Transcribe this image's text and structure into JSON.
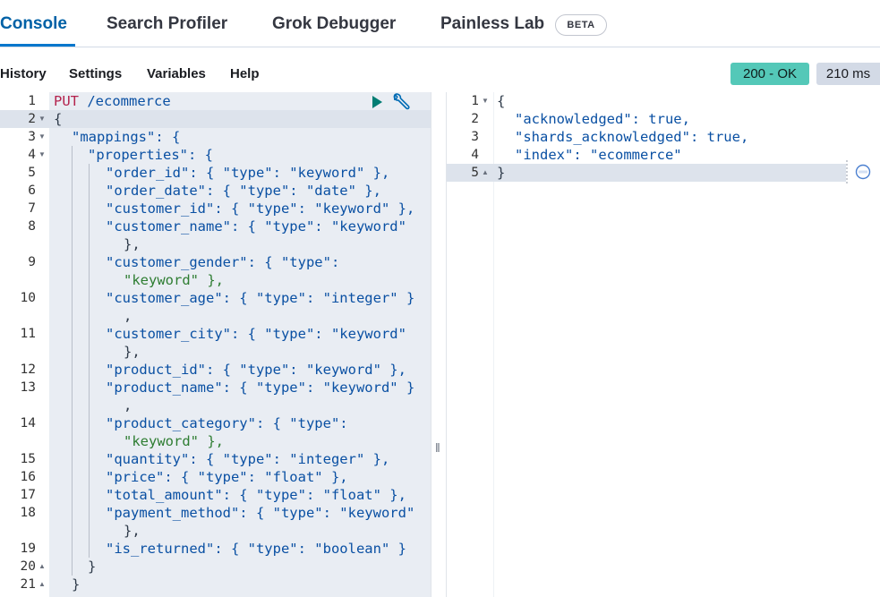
{
  "tabs": [
    "Console",
    "Search Profiler",
    "Grok Debugger",
    "Painless Lab"
  ],
  "beta_label": "BETA",
  "toolbar": [
    "History",
    "Settings",
    "Variables",
    "Help"
  ],
  "status": "200 - OK",
  "time": "210 ms",
  "request": {
    "method": "PUT",
    "path": "/ecommerce",
    "line_numbers": [
      "1",
      "2",
      "3",
      "4",
      "5",
      "6",
      "7",
      "8",
      "9",
      "10",
      "11",
      "12",
      "13",
      "14",
      "15",
      "16",
      "17",
      "18",
      "19",
      "20",
      "21"
    ]
  },
  "request_lines": [
    "{",
    "\"mappings\": {",
    "\"properties\": {",
    "\"order_id\": { \"type\": \"keyword\" },",
    "\"order_date\": { \"type\": \"date\" },",
    "\"customer_id\": { \"type\": \"keyword\" },",
    "\"customer_name\": { \"type\": \"keyword\"",
    "},",
    "\"customer_gender\": { \"type\":",
    "\"keyword\" },",
    "\"customer_age\": { \"type\": \"integer\" }",
    ",",
    "\"customer_city\": { \"type\": \"keyword\"",
    "},",
    "\"product_id\": { \"type\": \"keyword\" },",
    "\"product_name\": { \"type\": \"keyword\" }",
    ",",
    "\"product_category\": { \"type\":",
    "\"keyword\" },",
    "\"quantity\": { \"type\": \"integer\" },",
    "\"price\": { \"type\": \"float\" },",
    "\"total_amount\": { \"type\": \"float\" },",
    "\"payment_method\": { \"type\": \"keyword\"",
    "},",
    "\"is_returned\": { \"type\": \"boolean\" }",
    "}",
    "}"
  ],
  "response_line_numbers": [
    "1",
    "2",
    "3",
    "4",
    "5"
  ],
  "response_lines": [
    "{",
    "\"acknowledged\": true,",
    "\"shards_acknowledged\": true,",
    "\"index\": \"ecommerce\"",
    "}"
  ],
  "colors": {
    "accent": "#0077cc",
    "status_ok": "#54c8b8",
    "editor_bg": "#e9edf3"
  },
  "icons": [
    "play-icon",
    "wrench-icon",
    "fold-arrow-icon",
    "lint-badge-icon",
    "drag-handle-icon"
  ]
}
